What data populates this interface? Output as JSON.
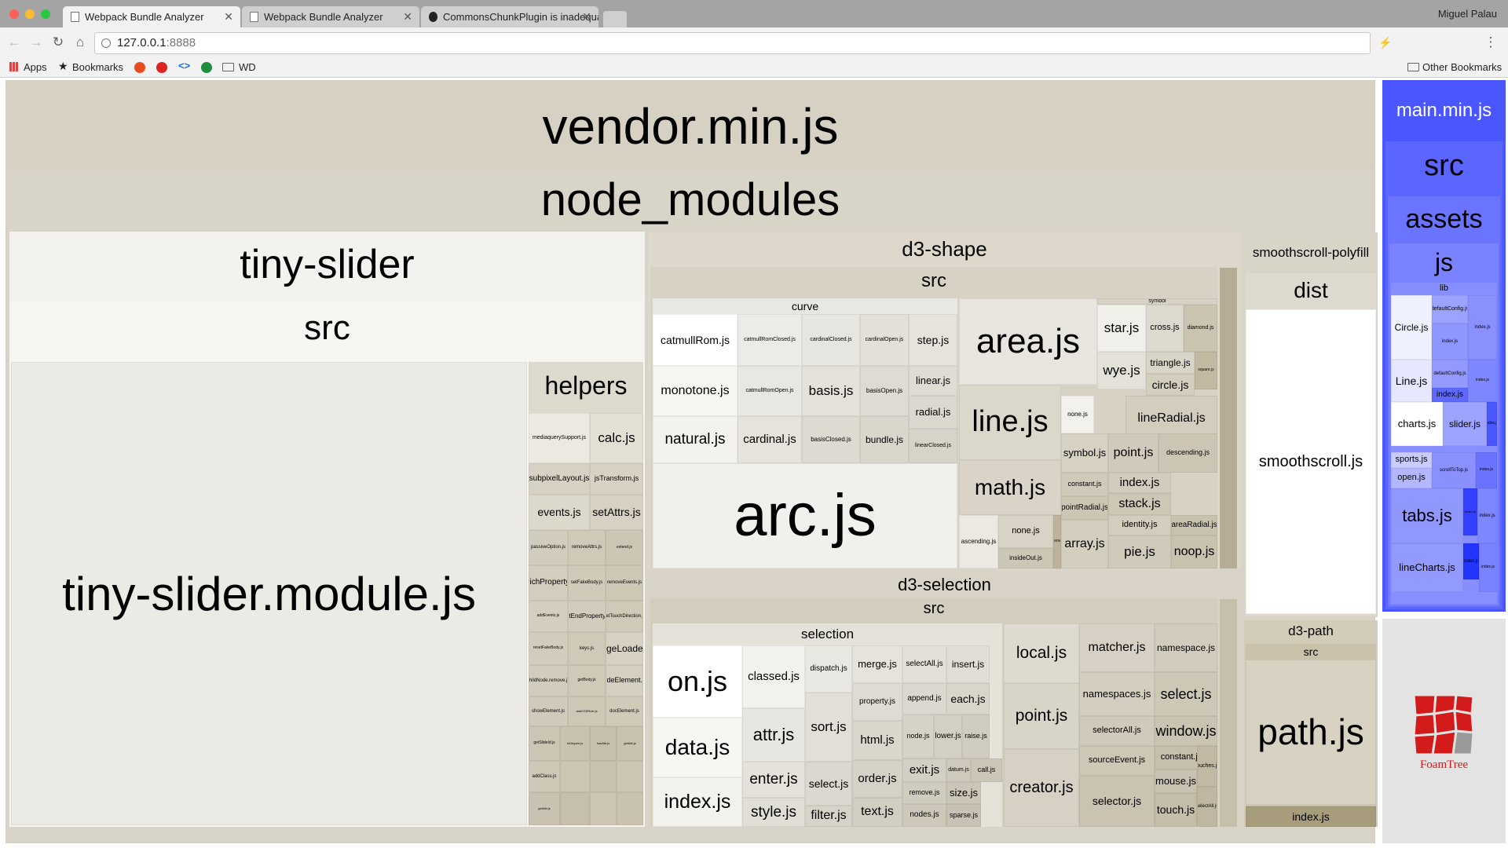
{
  "browser": {
    "tabs": [
      {
        "label": "Webpack Bundle Analyzer"
      },
      {
        "label": "Webpack Bundle Analyzer"
      },
      {
        "label": "CommonsChunkPlugin is inadequate"
      }
    ],
    "profile_name": "Miguel Palau",
    "url_host": "127.0.0.1",
    "url_port": ":8888",
    "bookmarks": {
      "apps": "Apps",
      "bookmarks": "Bookmarks",
      "wd": "WD",
      "other": "Other Bookmarks"
    },
    "colors": {
      "frame": "#a4a4a4",
      "toolbar": "#f2f2f2"
    }
  },
  "treemap": {
    "vendor": {
      "title": "vendor.min.js",
      "node_modules": "node_modules",
      "tiny_slider": {
        "title": "tiny-slider",
        "src": "src",
        "module": "tiny-slider.module.js",
        "helpers": {
          "title": "helpers",
          "items": [
            "mediaquerySupport.js",
            "calc.js",
            "subpixelLayout.js",
            "jsTransform.js",
            "events.js",
            "setAttrs.js",
            "passiveOption.js",
            "removeAttrs.js",
            "extend.js",
            "whichProperty.js",
            "setFakeBody.js",
            "removeEvents.js",
            "addEvents.js",
            "getEndProperty.js",
            "getTouchDirection.js",
            "resetFakeBody.js",
            "keys.js",
            "imageLoaded.js",
            "childNode.remove.js",
            "getBody.js",
            "hideElement.js",
            "showElement.js",
            "addCSSRule.js",
            "docElement.js",
            "getSlideId.js",
            "toDegree.js",
            "hasAttr.js",
            "getAttr.js",
            "addClass.js"
          ]
        }
      },
      "d3_shape": {
        "title": "d3-shape",
        "src": "src",
        "curve": {
          "title": "curve",
          "items": [
            "catmullRom.js",
            "catmullRomClosed.js",
            "cardinalClosed.js",
            "cardinalOpen.js",
            "step.js",
            "monotone.js",
            "catmullRomOpen.js",
            "basis.js",
            "basisOpen.js",
            "linear.js",
            "radial.js",
            "natural.js",
            "cardinal.js",
            "basisClosed.js",
            "bundle.js",
            "linearClosed.js"
          ]
        },
        "files": [
          "arc.js",
          "area.js",
          "line.js",
          "math.js",
          "star.js",
          "cross.js",
          "diamond.js",
          "wye.js",
          "triangle.js",
          "circle.js",
          "square.js",
          "symbol",
          "none.js",
          "lineRadial.js",
          "symbol.js",
          "point.js",
          "descending.js",
          "index.js",
          "pointRadial.js",
          "constant.js",
          "stack.js",
          "identity.js",
          "areaRadial.js",
          "ascending.js",
          "insideOut.js",
          "reverse.js",
          "array.js",
          "pie.js",
          "noop.js"
        ]
      },
      "d3_selection": {
        "title": "d3-selection",
        "src": "src",
        "selection": {
          "title": "selection",
          "items": [
            "on.js",
            "classed.js",
            "dispatch.js",
            "merge.js",
            "selectAll.js",
            "insert.js",
            "attr.js",
            "sort.js",
            "property.js",
            "append.js",
            "each.js",
            "data.js",
            "html.js",
            "node.js",
            "lower.js",
            "raise.js",
            "enter.js",
            "select.js",
            "exit.js",
            "datum.js",
            "call.js",
            "order.js",
            "remove.js",
            "size.js",
            "index.js",
            "style.js",
            "filter.js",
            "text.js",
            "nodes.js",
            "sparse.js"
          ]
        },
        "files": [
          "local.js",
          "matcher.js",
          "namespace.js",
          "namespaces.js",
          "select.js",
          "point.js",
          "selectorAll.js",
          "window.js",
          "sourceEvent.js",
          "constant.js",
          "touches.js",
          "creator.js",
          "mouse.js",
          "selector.js",
          "touch.js",
          "selectAll.js"
        ]
      },
      "smoothscroll": {
        "title": "smoothscroll-polyfill",
        "dist": "dist",
        "file": "smoothscroll.js"
      },
      "d3_path": {
        "title": "d3-path",
        "src": "src",
        "file": "path.js",
        "index": "index.js"
      }
    },
    "main": {
      "title": "main.min.js",
      "src": "src",
      "assets": "assets",
      "js": "js",
      "lib": "lib",
      "items": [
        "Circle.js",
        "defaultConfig.js",
        "index.js",
        "Line.js",
        "defaultConfig.js",
        "index.js",
        "charts.js",
        "slider.js",
        "sports.js",
        "open.js",
        "scrollToTop.js",
        "tabs.js",
        "lineCharts.js",
        "index.js"
      ]
    },
    "foamtree": "FoamTree",
    "colors": {
      "vendor": "#d6d1c3",
      "main": "#4455ff",
      "foamtree_red": "#d41b1b"
    }
  }
}
